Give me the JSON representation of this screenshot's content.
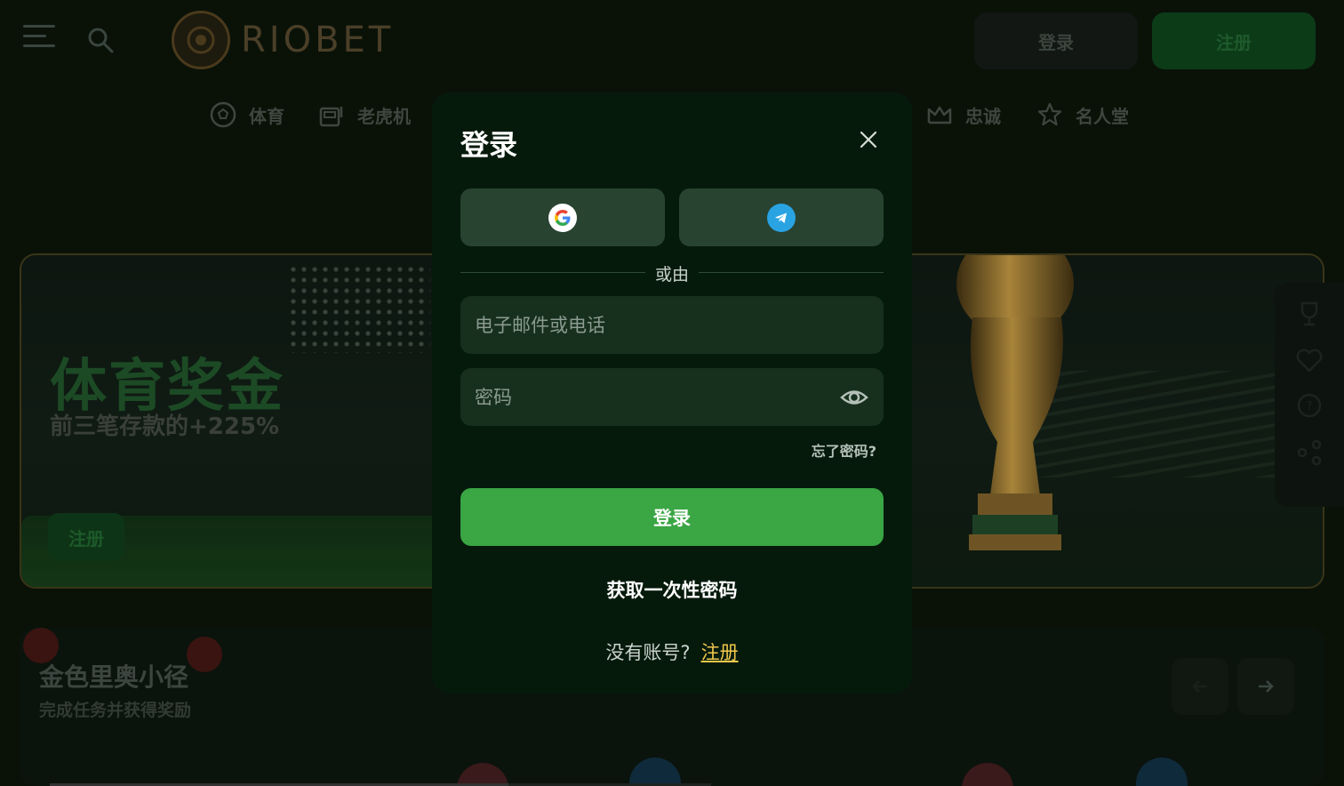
{
  "header": {
    "brand": "RIOBET",
    "login_label": "登录",
    "register_label": "注册"
  },
  "nav": {
    "items": [
      {
        "label": "体育",
        "icon": "soccer-ball-icon"
      },
      {
        "label": "老虎机",
        "icon": "slot-machine-icon"
      },
      {
        "label": "忠诚",
        "icon": "crown-icon"
      },
      {
        "label": "名人堂",
        "icon": "star-icon"
      }
    ]
  },
  "banner": {
    "title": "体育奖金",
    "subtitle": "前三笔存款的+225%",
    "button_label": "注册"
  },
  "quest": {
    "title": "金色里奥小径",
    "subtitle": "完成任务并获得奖励"
  },
  "modal": {
    "title": "登录",
    "divider_text": "或由",
    "email_placeholder": "电子邮件或电话",
    "password_placeholder": "密码",
    "forgot_label": "忘了密码?",
    "submit_label": "登录",
    "otp_label": "获取一次性密码",
    "no_account_text": "没有账号?",
    "signup_label": "注册"
  },
  "colors": {
    "modal_bg": "#061a0c",
    "field_bg": "#16301d",
    "social_bg": "#294331",
    "primary_green": "#3aa644",
    "link_yellow": "#f2c94c",
    "telegram_blue": "#2aa3e3"
  }
}
